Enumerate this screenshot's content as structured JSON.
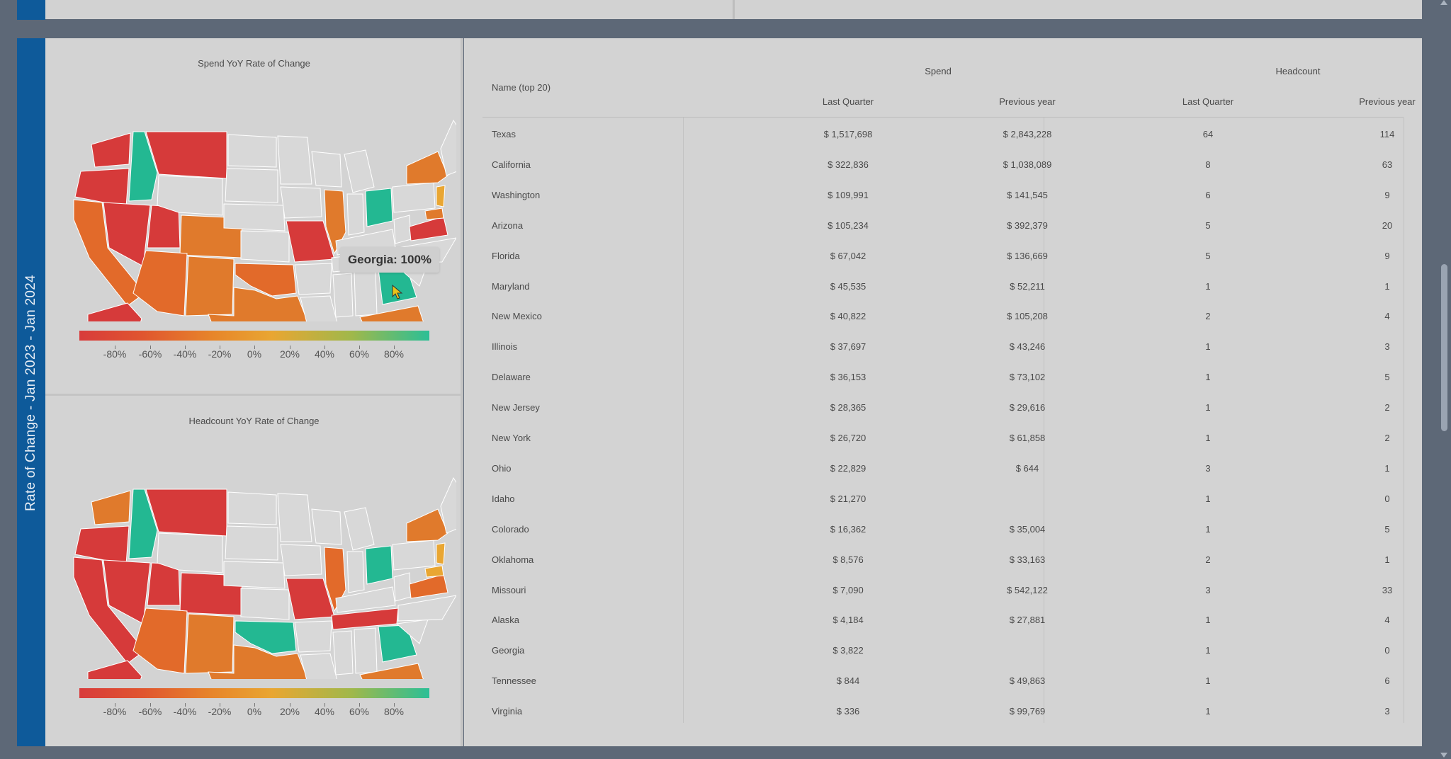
{
  "side_label": "Rate of Change - Jan 2023 - Jan 2024",
  "maps": [
    {
      "title": "Spend YoY Rate of Change",
      "tooltip": "Georgia: 100%",
      "legend_labels": [
        "-80%",
        "-60%",
        "-40%",
        "-20%",
        "0%",
        "20%",
        "40%",
        "60%",
        "80%"
      ]
    },
    {
      "title": "Headcount YoY Rate of Change",
      "legend_labels": [
        "-80%",
        "-60%",
        "-40%",
        "-20%",
        "0%",
        "20%",
        "40%",
        "60%",
        "80%"
      ]
    }
  ],
  "colors": {
    "red": "#d63a3a",
    "orange": "#e07a2c",
    "dark_orange": "#e26a2a",
    "teal": "#23b892",
    "gray_state": "#d8d8d8",
    "band_blue": "#0e5a9a"
  },
  "table": {
    "name_header": "Name (top 20)",
    "group_spend": "Spend",
    "group_headcount": "Headcount",
    "sub_last_quarter": "Last Quarter",
    "sub_previous_year": "Previous year",
    "rows": [
      {
        "name": "Texas",
        "spend_lq": "$ 1,517,698",
        "spend_py": "$ 2,843,228",
        "hc_lq": "64",
        "hc_py": "114"
      },
      {
        "name": "California",
        "spend_lq": "$ 322,836",
        "spend_py": "$ 1,038,089",
        "hc_lq": "8",
        "hc_py": "63"
      },
      {
        "name": "Washington",
        "spend_lq": "$ 109,991",
        "spend_py": "$ 141,545",
        "hc_lq": "6",
        "hc_py": "9"
      },
      {
        "name": "Arizona",
        "spend_lq": "$ 105,234",
        "spend_py": "$ 392,379",
        "hc_lq": "5",
        "hc_py": "20"
      },
      {
        "name": "Florida",
        "spend_lq": "$ 67,042",
        "spend_py": "$ 136,669",
        "hc_lq": "5",
        "hc_py": "9"
      },
      {
        "name": "Maryland",
        "spend_lq": "$ 45,535",
        "spend_py": "$ 52,211",
        "hc_lq": "1",
        "hc_py": "1"
      },
      {
        "name": "New Mexico",
        "spend_lq": "$ 40,822",
        "spend_py": "$ 105,208",
        "hc_lq": "2",
        "hc_py": "4"
      },
      {
        "name": "Illinois",
        "spend_lq": "$ 37,697",
        "spend_py": "$ 43,246",
        "hc_lq": "1",
        "hc_py": "3"
      },
      {
        "name": "Delaware",
        "spend_lq": "$ 36,153",
        "spend_py": "$ 73,102",
        "hc_lq": "1",
        "hc_py": "5"
      },
      {
        "name": "New Jersey",
        "spend_lq": "$ 28,365",
        "spend_py": "$ 29,616",
        "hc_lq": "1",
        "hc_py": "2"
      },
      {
        "name": "New York",
        "spend_lq": "$ 26,720",
        "spend_py": "$ 61,858",
        "hc_lq": "1",
        "hc_py": "2"
      },
      {
        "name": "Ohio",
        "spend_lq": "$ 22,829",
        "spend_py": "$ 644",
        "hc_lq": "3",
        "hc_py": "1"
      },
      {
        "name": "Idaho",
        "spend_lq": "$ 21,270",
        "spend_py": "",
        "hc_lq": "1",
        "hc_py": "0"
      },
      {
        "name": "Colorado",
        "spend_lq": "$ 16,362",
        "spend_py": "$ 35,004",
        "hc_lq": "1",
        "hc_py": "5"
      },
      {
        "name": "Oklahoma",
        "spend_lq": "$ 8,576",
        "spend_py": "$ 33,163",
        "hc_lq": "2",
        "hc_py": "1"
      },
      {
        "name": "Missouri",
        "spend_lq": "$ 7,090",
        "spend_py": "$ 542,122",
        "hc_lq": "3",
        "hc_py": "33"
      },
      {
        "name": "Alaska",
        "spend_lq": "$ 4,184",
        "spend_py": "$ 27,881",
        "hc_lq": "1",
        "hc_py": "4"
      },
      {
        "name": "Georgia",
        "spend_lq": "$ 3,822",
        "spend_py": "",
        "hc_lq": "1",
        "hc_py": "0"
      },
      {
        "name": "Tennessee",
        "spend_lq": "$ 844",
        "spend_py": "$ 49,863",
        "hc_lq": "1",
        "hc_py": "6"
      },
      {
        "name": "Virginia",
        "spend_lq": "$ 336",
        "spend_py": "$ 99,769",
        "hc_lq": "1",
        "hc_py": "3"
      }
    ]
  }
}
